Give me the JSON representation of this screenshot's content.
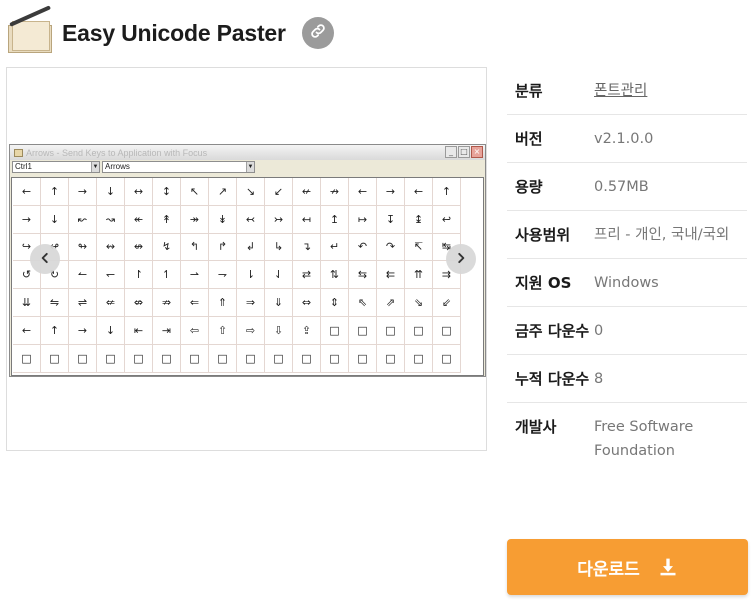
{
  "header": {
    "title": "Easy Unicode Paster",
    "app_icon": "quill-paper-icon",
    "link_icon": "link-icon"
  },
  "screenshot": {
    "window_title": "Arrows - Send Keys to Application with Focus",
    "combo_modifier": "Ctrl1",
    "combo_category": "Arrows",
    "window_buttons": [
      "_",
      "□",
      "×"
    ],
    "symbols": [
      [
        "←",
        "↑",
        "→",
        "↓",
        "↔",
        "↕",
        "↖",
        "↗",
        "↘",
        "↙",
        "↚",
        "↛",
        "←",
        "→",
        "←",
        "↑"
      ],
      [
        "→",
        "↓",
        "↜",
        "↝",
        "↞",
        "↟",
        "↠",
        "↡",
        "↢",
        "↣",
        "↤",
        "↥",
        "↦",
        "↧",
        "↨",
        "↩"
      ],
      [
        "↪",
        "↫",
        "↬",
        "↭",
        "↮",
        "↯",
        "↰",
        "↱",
        "↲",
        "↳",
        "↴",
        "↵",
        "↶",
        "↷",
        "↸",
        "↹"
      ],
      [
        "↺",
        "↻",
        "↼",
        "↽",
        "↾",
        "↿",
        "⇀",
        "⇁",
        "⇂",
        "⇃",
        "⇄",
        "⇅",
        "⇆",
        "⇇",
        "⇈",
        "⇉"
      ],
      [
        "⇊",
        "⇋",
        "⇌",
        "⇍",
        "⇎",
        "⇏",
        "⇐",
        "⇑",
        "⇒",
        "⇓",
        "⇔",
        "⇕",
        "⇖",
        "⇗",
        "⇘",
        "⇙"
      ],
      [
        "←",
        "↑",
        "→",
        "↓",
        "⇤",
        "⇥",
        "⇦",
        "⇧",
        "⇨",
        "⇩",
        "⇪",
        "□",
        "□",
        "□",
        "□",
        "□"
      ],
      [
        "□",
        "□",
        "□",
        "□",
        "□",
        "□",
        "□",
        "□",
        "□",
        "□",
        "□",
        "□",
        "□",
        "□",
        "□",
        "□"
      ]
    ],
    "prev_icon": "chevron-left-icon",
    "next_icon": "chevron-right-icon"
  },
  "info": [
    {
      "key": "분류",
      "value": "폰트관리",
      "link": true
    },
    {
      "key": "버전",
      "value": "v2.1.0.0"
    },
    {
      "key": "용량",
      "value": "0.57MB"
    },
    {
      "key": "사용범위",
      "value": "프리 - 개인, 국내/국외"
    },
    {
      "key": "지원 OS",
      "value": "Windows"
    },
    {
      "key": "금주 다운수",
      "value": "0"
    },
    {
      "key": "누적 다운수",
      "value": "8"
    },
    {
      "key": "개발사",
      "value": "Free Software Foundation"
    }
  ],
  "download": {
    "label": "다운로드",
    "icon": "download-icon"
  },
  "colors": {
    "accent": "#f79d33",
    "link_button": "#9b9b9b"
  }
}
